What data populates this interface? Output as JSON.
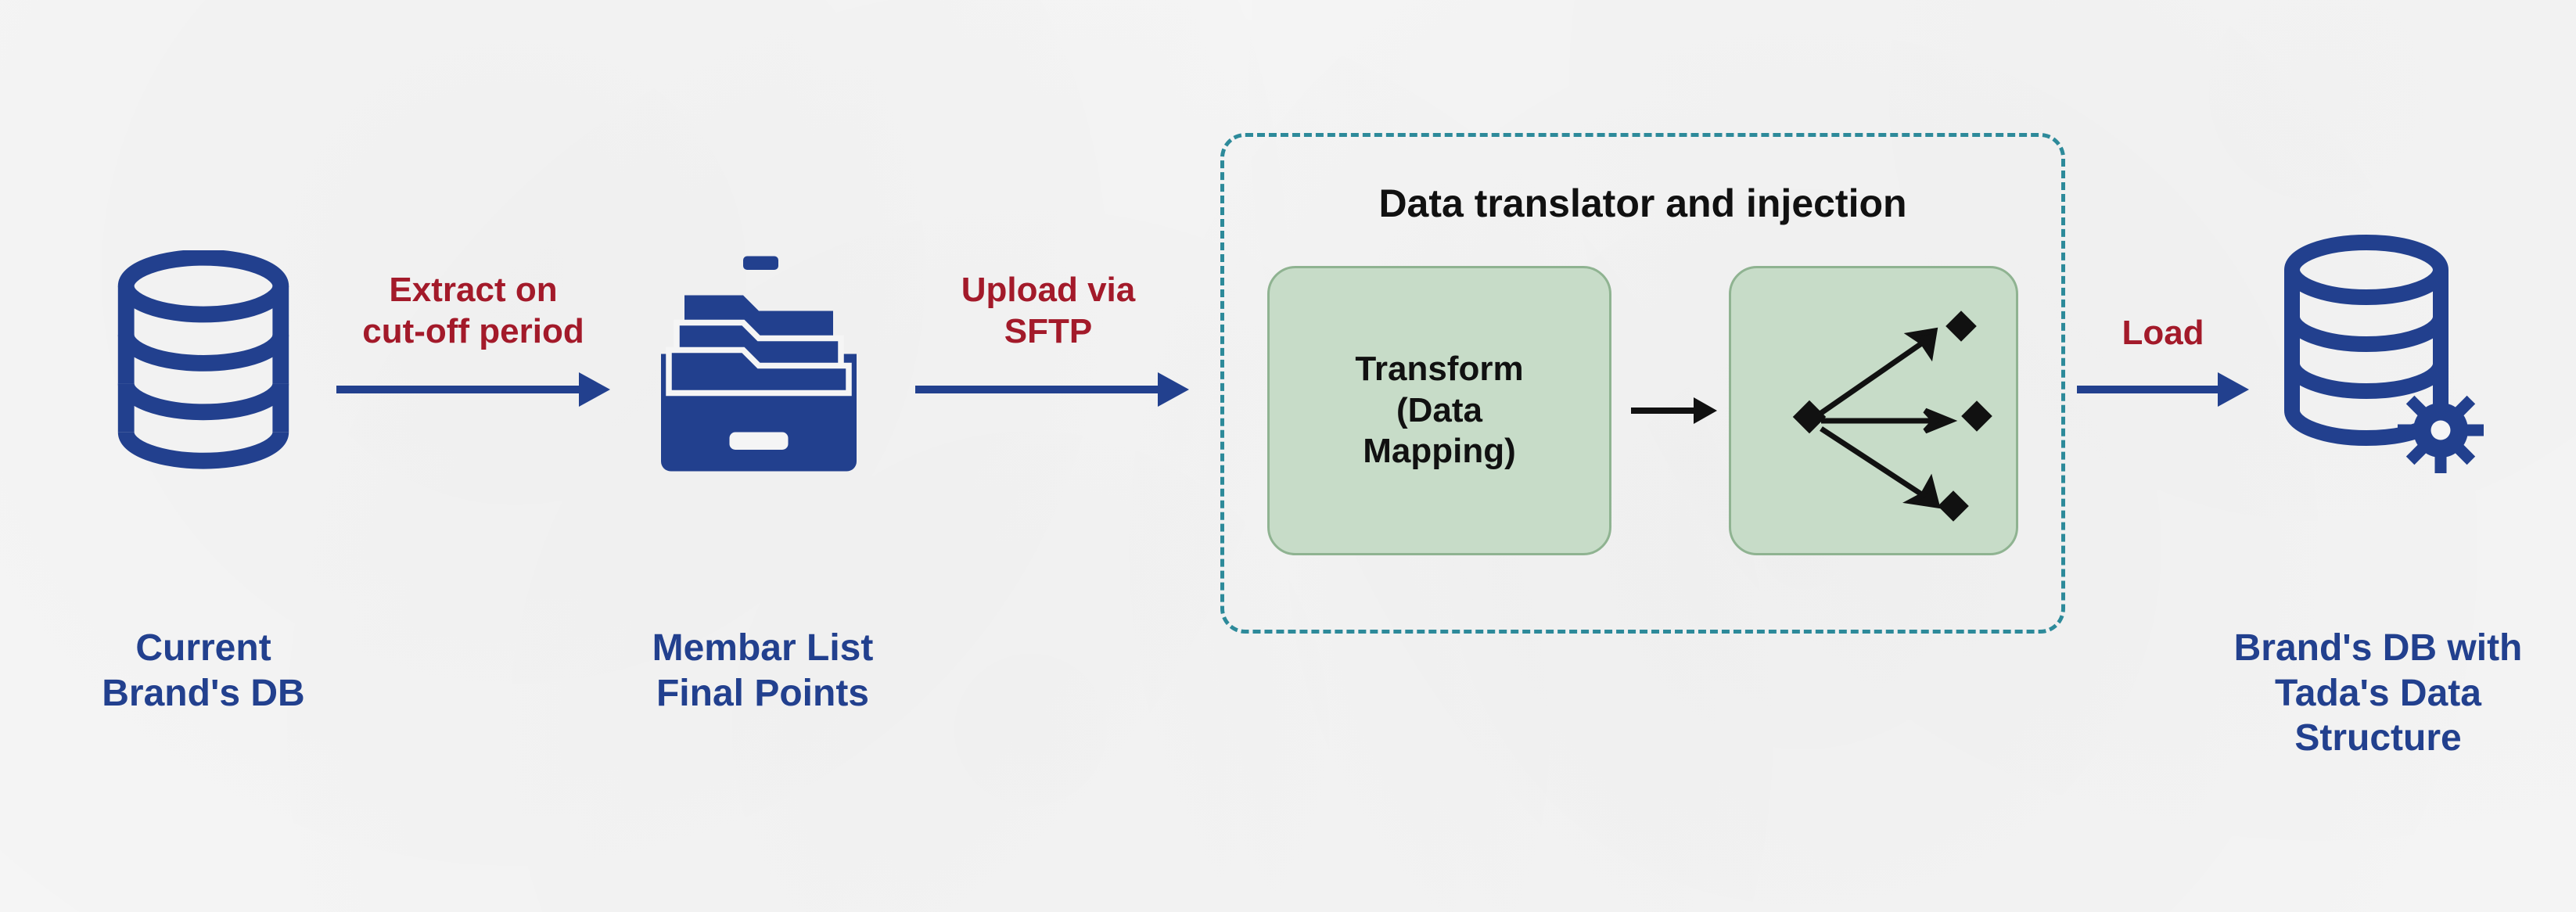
{
  "nodes": {
    "source_db": {
      "label_line1": "Current",
      "label_line2": "Brand's DB"
    },
    "file_box": {
      "label_line1": "Membar List",
      "label_line2": "Final Points"
    },
    "section_title": "Data translator and injection",
    "transform": {
      "label_line1": "Transform",
      "label_line2": "(Data",
      "label_line3": "Mapping)"
    },
    "target_db": {
      "label_line1": "Brand's DB with",
      "label_line2": "Tada's Data",
      "label_line3": "Structure"
    }
  },
  "arrows": {
    "extract": {
      "label_line1": "Extract on",
      "label_line2": "cut-off period"
    },
    "upload": {
      "label_line1": "Upload via",
      "label_line2": "SFTP"
    },
    "load": {
      "label": "Load"
    }
  }
}
